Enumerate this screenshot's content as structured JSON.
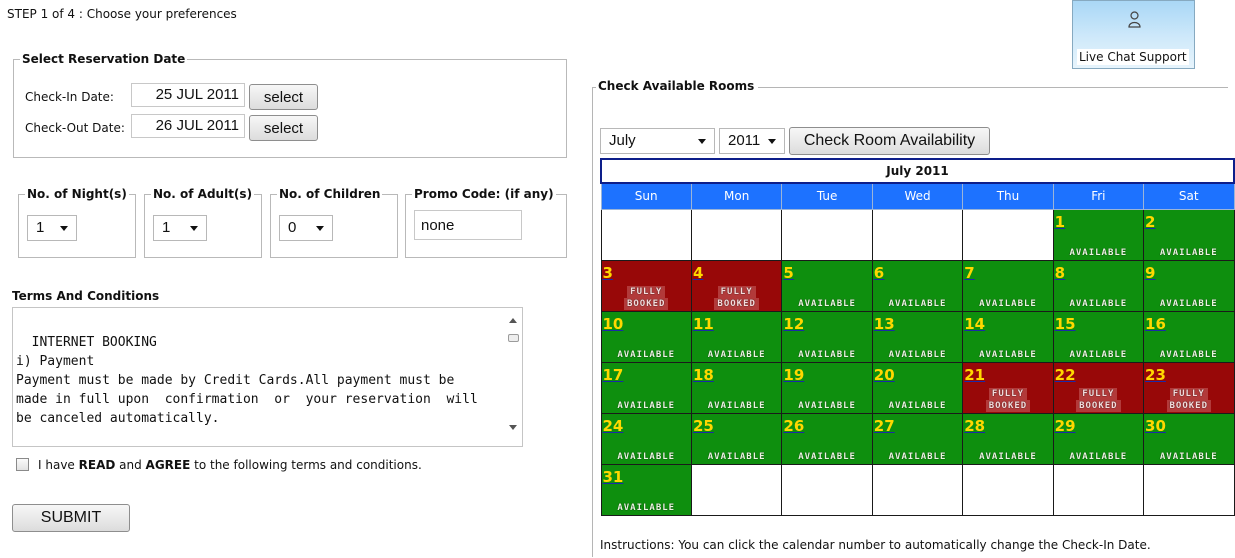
{
  "step_text": "STEP 1 of 4 : Choose your preferences",
  "reservation": {
    "legend": "Select Reservation Date",
    "checkin_label": "Check-In Date:",
    "checkin_value": "25 JUL 2011",
    "checkout_label": "Check-Out Date:",
    "checkout_value": "26 JUL 2011",
    "select_label": "select"
  },
  "options": {
    "nights": {
      "legend": "No. of Night(s)",
      "value": "1"
    },
    "adults": {
      "legend": "No. of Adult(s)",
      "value": "1"
    },
    "children": {
      "legend": "No. of Children",
      "value": "0"
    },
    "promo": {
      "legend": "Promo Code: (if any)",
      "value": "none"
    }
  },
  "terms": {
    "title": "Terms And Conditions",
    "text": "INTERNET BOOKING\ni) Payment\nPayment must be made by Credit Cards.All payment must be made in full upon  confirmation  or  your reservation  will be canceled automatically.",
    "agree_prefix": "I have ",
    "agree_read": "READ",
    "agree_and": " and ",
    "agree_agree": "AGREE",
    "agree_suffix": " to the following terms and conditions."
  },
  "submit_label": "SUBMIT",
  "chat": {
    "label": "Live Chat Support",
    "icon": "person-icon"
  },
  "calendar": {
    "legend": "Check Available Rooms",
    "month_value": "July",
    "year_value": "2011",
    "check_button": "Check Room Availability",
    "header": "July 2011",
    "days": [
      "Sun",
      "Mon",
      "Tue",
      "Wed",
      "Thu",
      "Fri",
      "Sat"
    ],
    "available_text": "AVAILABLE",
    "fully_text": "FULLY",
    "booked_text": "BOOKED",
    "colors": {
      "available": "#0e8f0e",
      "booked": "#980808",
      "day_header": "#1d72ff",
      "number": "#ffd800"
    },
    "weeks": [
      [
        null,
        null,
        null,
        null,
        null,
        {
          "d": "1",
          "s": "a"
        },
        {
          "d": "2",
          "s": "a"
        }
      ],
      [
        {
          "d": "3",
          "s": "b"
        },
        {
          "d": "4",
          "s": "b"
        },
        {
          "d": "5",
          "s": "a"
        },
        {
          "d": "6",
          "s": "a"
        },
        {
          "d": "7",
          "s": "a"
        },
        {
          "d": "8",
          "s": "a"
        },
        {
          "d": "9",
          "s": "a"
        }
      ],
      [
        {
          "d": "10",
          "s": "a"
        },
        {
          "d": "11",
          "s": "a"
        },
        {
          "d": "12",
          "s": "a"
        },
        {
          "d": "13",
          "s": "a"
        },
        {
          "d": "14",
          "s": "a"
        },
        {
          "d": "15",
          "s": "a"
        },
        {
          "d": "16",
          "s": "a"
        }
      ],
      [
        {
          "d": "17",
          "s": "a"
        },
        {
          "d": "18",
          "s": "a"
        },
        {
          "d": "19",
          "s": "a"
        },
        {
          "d": "20",
          "s": "a"
        },
        {
          "d": "21",
          "s": "b"
        },
        {
          "d": "22",
          "s": "b"
        },
        {
          "d": "23",
          "s": "b"
        }
      ],
      [
        {
          "d": "24",
          "s": "a"
        },
        {
          "d": "25",
          "s": "a"
        },
        {
          "d": "26",
          "s": "a"
        },
        {
          "d": "27",
          "s": "a"
        },
        {
          "d": "28",
          "s": "a"
        },
        {
          "d": "29",
          "s": "a"
        },
        {
          "d": "30",
          "s": "a"
        }
      ],
      [
        {
          "d": "31",
          "s": "a"
        },
        null,
        null,
        null,
        null,
        null,
        null
      ]
    ],
    "instructions": "Instructions: You can click the calendar number to automatically change the Check-In Date."
  }
}
